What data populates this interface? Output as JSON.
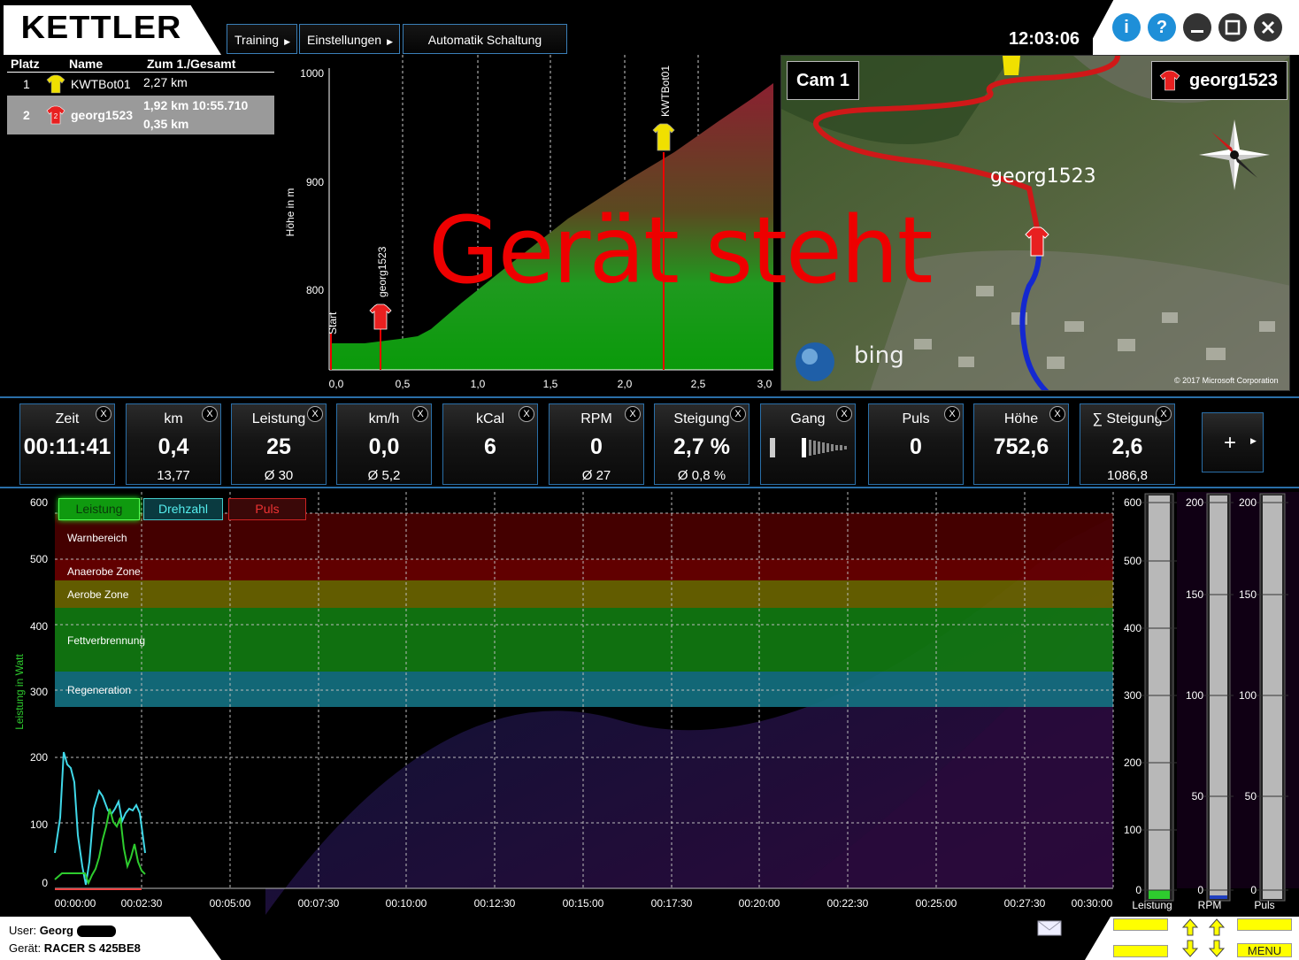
{
  "app": {
    "logo": "KETTLER",
    "clock": "12:03:06"
  },
  "menu": {
    "training": "Training",
    "settings": "Einstellungen",
    "auto_shift": "Automatik Schaltung"
  },
  "window_buttons": {
    "info": "i",
    "help": "?"
  },
  "ranking": {
    "headers": [
      "Platz",
      "Name",
      "Zum 1./Gesamt"
    ],
    "rows": [
      {
        "place": "1",
        "name": "KWTBot01",
        "dist": "2,27 km",
        "dist2": ""
      },
      {
        "place": "2",
        "name": "georg1523",
        "dist": "1,92 km 10:55.710",
        "dist2": "0,35 km"
      }
    ]
  },
  "elevation": {
    "ylabel": "Höhe in m",
    "yticks": [
      "1000",
      "900",
      "800"
    ],
    "xticks": [
      "0,0",
      "0,5",
      "1,0",
      "1,5",
      "2,0",
      "2,5",
      "3,0"
    ],
    "marker_start": "Start",
    "marker_user": "georg1523",
    "marker_bot": "KWTBot01"
  },
  "overlay_text": "Gerät steht",
  "map": {
    "cam": "Cam 1",
    "user": "georg1523",
    "route_label": "georg1523",
    "bing": "bing",
    "copyright": "© 2017 Microsoft Corporation"
  },
  "tiles": [
    {
      "label": "Zeit",
      "value": "00:11:41",
      "sub": ""
    },
    {
      "label": "km",
      "value": "0,4",
      "sub": "13,77"
    },
    {
      "label": "Leistung",
      "value": "25",
      "sub": "Ø 30"
    },
    {
      "label": "km/h",
      "value": "0,0",
      "sub": "Ø 5,2"
    },
    {
      "label": "kCal",
      "value": "6",
      "sub": ""
    },
    {
      "label": "RPM",
      "value": "0",
      "sub": "Ø 27"
    },
    {
      "label": "Steigung",
      "value": "2,7 %",
      "sub": "Ø 0,8 %"
    },
    {
      "label": "Gang",
      "value": "",
      "sub": ""
    },
    {
      "label": "Puls",
      "value": "0",
      "sub": ""
    },
    {
      "label": "Höhe",
      "value": "752,6",
      "sub": ""
    },
    {
      "label": "∑ Steigung",
      "value": "2,6",
      "sub": "1086,8"
    }
  ],
  "tile_close": "X",
  "add_tile": "+",
  "power": {
    "tabs": [
      "Leistung",
      "Drehzahl",
      "Puls"
    ],
    "ylabel": "Leistung in Watt",
    "yticks": [
      "600",
      "500",
      "400",
      "300",
      "200",
      "100",
      "0"
    ],
    "xticks": [
      "00:00:00",
      "00:02:30",
      "00:05:00",
      "00:07:30",
      "00:10:00",
      "00:12:30",
      "00:15:00",
      "00:17:30",
      "00:20:00",
      "00:22:30",
      "00:25:00",
      "00:27:30",
      "00:30:00"
    ],
    "zones": [
      "Warnbereich",
      "Anaerobe Zone",
      "Aerobe Zone",
      "Fettverbrennung",
      "Regeneration"
    ],
    "colors": {
      "leistung": "#2ecc2e",
      "drehzahl": "#40d8e8",
      "puls": "#e02020"
    }
  },
  "gauges": [
    {
      "label": "Leistung",
      "ticks": [
        "600",
        "500",
        "400",
        "300",
        "200",
        "100",
        "0"
      ],
      "fraction": 0.04
    },
    {
      "label": "RPM",
      "ticks": [
        "200",
        "150",
        "100",
        "50",
        "0"
      ],
      "fraction": 0.01
    },
    {
      "label": "Puls",
      "ticks": [
        "200",
        "150",
        "100",
        "50",
        "0"
      ],
      "fraction": 0
    }
  ],
  "footer": {
    "user_label": "User:",
    "user": "Georg",
    "device_label": "Gerät:",
    "device": "RACER S 425BE8",
    "menu": "MENU"
  }
}
